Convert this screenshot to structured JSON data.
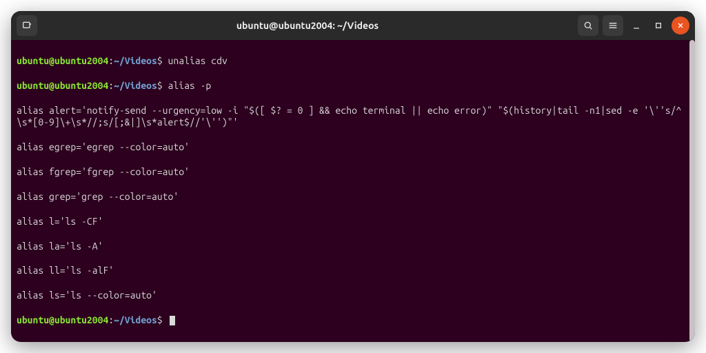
{
  "window": {
    "title": "ubuntu@ubuntu2004: ~/Videos"
  },
  "prompt": {
    "user_host": "ubuntu@ubuntu2004",
    "colon": ":",
    "path": "~/Videos",
    "dollar": "$"
  },
  "lines": {
    "cmd1": "unalias cdv",
    "cmd2": "alias -p",
    "out0": "alias alert='notify-send --urgency=low -i \"$([ $? = 0 ] && echo terminal || echo error)\" \"$(history|tail -n1|sed -e '\\''s/^\\s*[0-9]\\+\\s*//;s/[;&|]\\s*alert$//'\\'')\"'",
    "out1": "alias egrep='egrep --color=auto'",
    "out2": "alias fgrep='fgrep --color=auto'",
    "out3": "alias grep='grep --color=auto'",
    "out4": "alias l='ls -CF'",
    "out5": "alias la='ls -A'",
    "out6": "alias ll='ls -alF'",
    "out7": "alias ls='ls --color=auto'"
  },
  "icons": {
    "newtab": "new-tab",
    "search": "search",
    "menu": "hamburger-menu",
    "minimize": "minimize",
    "maximize": "maximize",
    "close": "close"
  }
}
